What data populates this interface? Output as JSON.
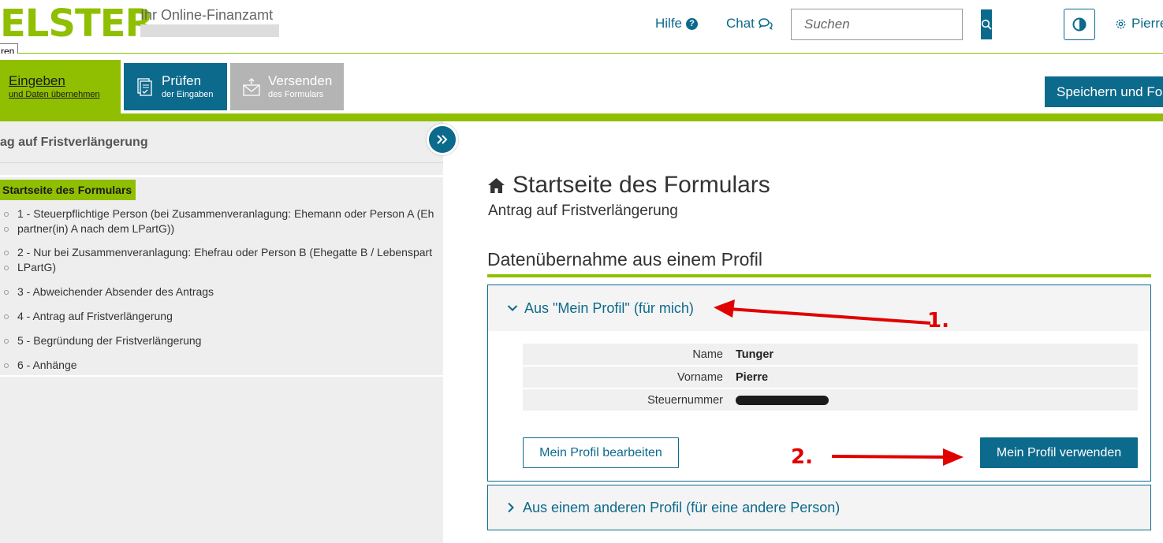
{
  "header": {
    "logo": "ELSTER",
    "subtitle": "Ihr Online-Finanzamt",
    "tooltip": "ren",
    "help_label": "Hilfe",
    "chat_label": "Chat",
    "search_placeholder": "Suchen",
    "user_label": "Pierre"
  },
  "tabs": [
    {
      "label": "Eingeben",
      "sub": "und Daten übernehmen"
    },
    {
      "label": "Prüfen",
      "sub": "der Eingaben"
    },
    {
      "label": "Versenden",
      "sub": "des Formulars"
    }
  ],
  "save_button": "Speichern und For",
  "sidebar": {
    "title": "ag auf Fristverlängerung",
    "active_item": "Startseite des Formulars",
    "items": [
      "1 - Steuerpflichtige Person (bei Zusammenveranlagung: Ehemann oder Person A (Eh",
      "partner(in) A nach dem LPartG))",
      "2 - Nur bei Zusammenveranlagung: Ehefrau oder Person B (Ehegatte B / Lebenspart",
      "LPartG)",
      "3 - Abweichender Absender des Antrags",
      "4 - Antrag auf Fristverlängerung",
      "5 - Begründung der Fristverlängerung",
      "6 - Anhänge"
    ]
  },
  "main": {
    "title": "Startseite des Formulars",
    "subtitle": "Antrag auf Fristverlängerung",
    "section_title": "Datenübernahme aus einem Profil",
    "accordion1": {
      "title": "Aus \"Mein Profil\" (für mich)",
      "rows": [
        {
          "label": "Name",
          "value": "Tunger"
        },
        {
          "label": "Vorname",
          "value": "Pierre"
        },
        {
          "label": "Steuernummer",
          "value": ""
        }
      ],
      "edit_button": "Mein Profil bearbeiten",
      "use_button": "Mein Profil verwenden"
    },
    "accordion2": {
      "title": "Aus einem anderen Profil (für eine andere Person)"
    }
  },
  "annotations": {
    "step1": "1.",
    "step2": "2.",
    "color": "#e00000"
  },
  "colors": {
    "brand_green": "#8fbf00",
    "accent_blue": "#0c6a8c"
  }
}
